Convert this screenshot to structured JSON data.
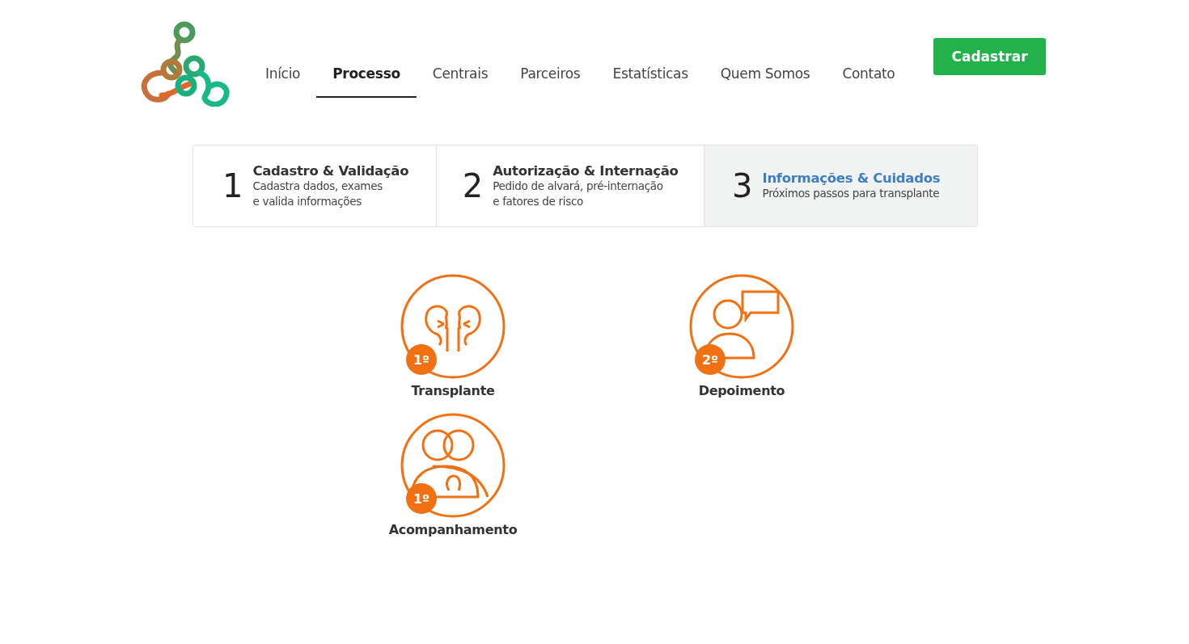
{
  "header": {
    "nav": [
      {
        "label": "Início",
        "selected": false
      },
      {
        "label": "Processo",
        "selected": true
      },
      {
        "label": "Centrais",
        "selected": false
      },
      {
        "label": "Parceiros",
        "selected": false
      },
      {
        "label": "Estatísticas",
        "selected": false
      },
      {
        "label": "Quem Somos",
        "selected": false
      },
      {
        "label": "Contato",
        "selected": false
      }
    ],
    "signup_button": "Cadastrar"
  },
  "steps": [
    {
      "number": "1",
      "title": "Cadastro & Validação",
      "lines": [
        "Cadastra dados, exames",
        "e valida informações"
      ],
      "selected": false
    },
    {
      "number": "2",
      "title": "Autorização & Internação",
      "lines": [
        "Pedido de alvará, pré-internação",
        "e fatores de risco"
      ],
      "selected": false
    },
    {
      "number": "3",
      "title": "Informações & Cuidados",
      "lines": [
        "Próximos passos para transplante"
      ],
      "selected": true
    }
  ],
  "cards": [
    {
      "kind": "kidneys",
      "badge": "1º",
      "label": "Transplante"
    },
    {
      "kind": "speaker",
      "badge": "2º",
      "label": "Depoimento"
    },
    {
      "kind": "pair",
      "badge": "1º",
      "label": "Acompanhamento"
    }
  ]
}
